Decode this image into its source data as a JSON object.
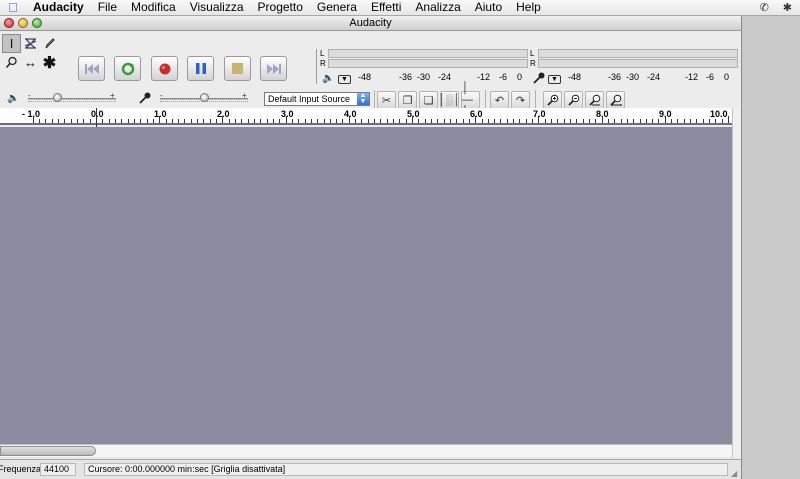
{
  "menubar": {
    "items": [
      "Audacity",
      "File",
      "Modifica",
      "Visualizza",
      "Progetto",
      "Genera",
      "Effetti",
      "Analizza",
      "Aiuto",
      "Help"
    ]
  },
  "window": {
    "title": "Audacity"
  },
  "tools": [
    "selection-tool",
    "envelope-tool",
    "draw-tool",
    "zoom-tool",
    "timeshift-tool",
    "multi-tool"
  ],
  "meters": {
    "playback": {
      "left_label": "L",
      "right_label": "R",
      "scale": [
        "-48",
        "-36",
        "-30",
        "-24",
        "-12",
        "-6",
        "0"
      ]
    },
    "record": {
      "left_label": "L",
      "right_label": "R",
      "scale": [
        "-48",
        "-36",
        "-30",
        "-24",
        "-12",
        "-6",
        "0"
      ]
    }
  },
  "mixer": {
    "minus": "-",
    "plus": "+",
    "input_source": "Default Input Source"
  },
  "ruler": {
    "labels": [
      "- 1.0",
      "0.0",
      "1.0",
      "2.0",
      "3.0",
      "4.0",
      "5.0",
      "6.0",
      "7.0",
      "8.0",
      "9.0",
      "10.0"
    ]
  },
  "status": {
    "rate_label": "Frequenza:",
    "rate_value": "44100",
    "cursor": "Cursore: 0:00.000000 min:sec  [Griglia disattivata]"
  },
  "colors": {
    "track_background": "#8c8b9f",
    "record_red": "#c33030",
    "pause_blue": "#2f5fc8",
    "play_green": "#3a9a3a"
  }
}
